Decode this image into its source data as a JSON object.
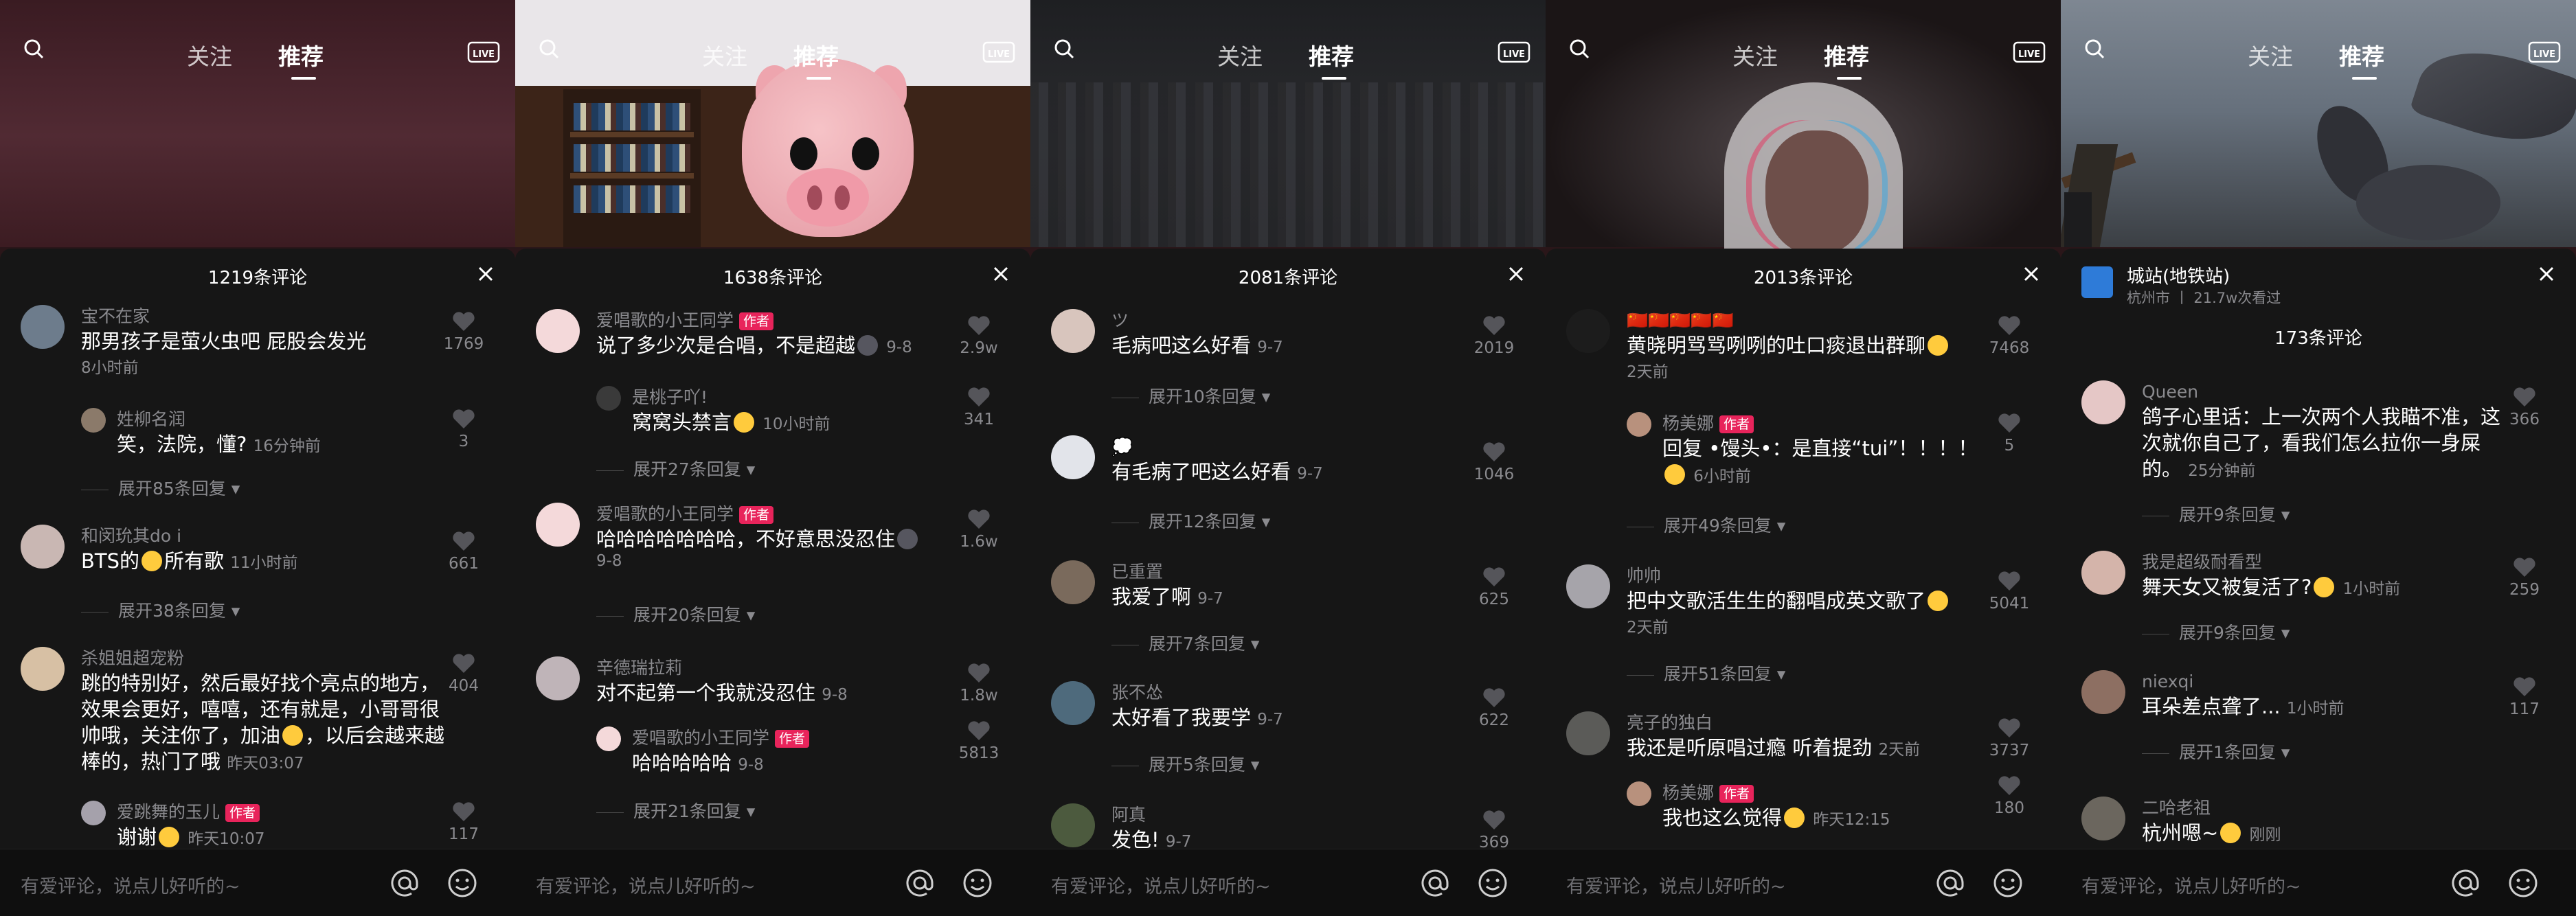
{
  "screens": [
    {
      "nav": {
        "follow": "关注",
        "recommend": "推荐"
      },
      "sheet_title": "1219条评论",
      "input_placeholder": "有爱评论，说点儿好听的~",
      "comments": [
        {
          "name": "宝不在家",
          "text": "那男孩子是萤火虫吧 屁股会发光",
          "time": "8小时前",
          "likes": "1769"
        },
        {
          "name": "姓柳名润",
          "text": "笑，法院，懂?",
          "time": "16分钟前",
          "likes": "3"
        },
        {
          "expand": "展开85条回复"
        },
        {
          "name": "和闵玧其do i",
          "text_a": "BTS的",
          "text_b": "所有歌",
          "time": "11小时前",
          "likes": "661"
        },
        {
          "expand": "展开38条回复"
        },
        {
          "name": "杀姐姐超宠粉",
          "text": "跳的特别好，然后最好找个亮点的地方，效果会更好，嘻嘻，还有就是，小哥哥很帅哦，关注你了，加油",
          "text_b": "，以后会越来越棒的，热门了哦",
          "time": "昨天03:07",
          "likes": "404"
        },
        {
          "name": "爱跳舞的玉儿",
          "author": "作者",
          "text": "谢谢",
          "time": "昨天10:07",
          "likes": "117"
        }
      ]
    },
    {
      "nav": {
        "follow": "关注",
        "recommend": "推荐"
      },
      "sheet_title": "1638条评论",
      "input_placeholder": "有爱评论，说点儿好听的~",
      "comments": [
        {
          "name": "爱唱歌的小王同学",
          "author": "作者",
          "text": "说了多少次是合唱，不是超越",
          "time": "9-8",
          "likes": "2.9w"
        },
        {
          "name": "是桃子吖!",
          "text": "窝窝头禁言",
          "time": "10小时前",
          "likes": "341"
        },
        {
          "expand": "展开27条回复"
        },
        {
          "name": "爱唱歌的小王同学",
          "author": "作者",
          "text": "哈哈哈哈哈哈哈，不好意思没忍住",
          "time": "9-8",
          "likes": "1.6w"
        },
        {
          "expand": "展开20条回复"
        },
        {
          "name": "辛德瑞拉莉",
          "text": "对不起第一个我就没忍住",
          "time": "9-8",
          "likes": "1.8w"
        },
        {
          "name": "爱唱歌的小王同学",
          "author": "作者",
          "text": "哈哈哈哈哈",
          "time": "9-8",
          "likes": "5813"
        },
        {
          "expand": "展开21条回复"
        }
      ]
    },
    {
      "nav": {
        "follow": "关注",
        "recommend": "推荐"
      },
      "sheet_title": "2081条评论",
      "input_placeholder": "有爱评论，说点儿好听的~",
      "comments": [
        {
          "name": "ツ",
          "text": "毛病吧这么好看",
          "time": "9-7",
          "likes": "2019"
        },
        {
          "expand": "展开10条回复"
        },
        {
          "name": "💭",
          "text": "有毛病了吧这么好看",
          "time": "9-7",
          "likes": "1046"
        },
        {
          "expand": "展开12条回复"
        },
        {
          "name": "已重置",
          "text": "我爱了啊",
          "time": "9-7",
          "likes": "625"
        },
        {
          "expand": "展开7条回复"
        },
        {
          "name": "张不怂",
          "text": "太好看了我要学",
          "time": "9-7",
          "likes": "622"
        },
        {
          "expand": "展开5条回复"
        },
        {
          "name": "阿真",
          "text": "发色!",
          "time": "9-7",
          "likes": "369"
        }
      ]
    },
    {
      "nav": {
        "follow": "关注",
        "recommend": "推荐"
      },
      "sheet_title": "2013条评论",
      "input_placeholder": "有爱评论，说点儿好听的~",
      "comments": [
        {
          "name": "🇨🇳🇨🇳🇨🇳🇨🇳🇨🇳",
          "text": "黄晓明骂骂咧咧的吐口痰退出群聊",
          "time": "2天前",
          "likes": "7468"
        },
        {
          "name": "杨美娜",
          "author": "作者",
          "text": "回复 •馒头•：是直接“tui”！！！！",
          "time": "6小时前",
          "likes": "5"
        },
        {
          "expand": "展开49条回复"
        },
        {
          "name": "帅帅",
          "text": "把中文歌活生生的翻唱成英文歌了",
          "time": "2天前",
          "likes": "5041"
        },
        {
          "expand": "展开51条回复"
        },
        {
          "name": "亮子的独白",
          "text": "我还是听原唱过瘾 听着提劲",
          "time": "2天前",
          "likes": "3737"
        },
        {
          "name": "杨美娜",
          "author": "作者",
          "text": "我也这么觉得",
          "time": "昨天12:15",
          "likes": "180"
        }
      ]
    },
    {
      "nav": {
        "follow": "关注",
        "recommend": "推荐"
      },
      "location": {
        "name": "城站(地铁站)",
        "sub": "杭州市 丨 21.7w次看过"
      },
      "sheet_title": "173条评论",
      "input_placeholder": "有爱评论，说点儿好听的~",
      "comments": [
        {
          "name": "Queen",
          "text": "鸽子心里话：上一次两个人我瞄不准，这次就你自己了，看我们怎么拉你一身屎的。",
          "time": "25分钟前",
          "likes": "366"
        },
        {
          "expand": "展开9条回复"
        },
        {
          "name": "我是超级耐看型",
          "text": "舞天女又被复活了?",
          "time": "1小时前",
          "likes": "259"
        },
        {
          "expand": "展开9条回复"
        },
        {
          "name": "niexqi",
          "text": "耳朵差点聋了...",
          "time": "1小时前",
          "likes": "117"
        },
        {
          "expand": "展开1条回复"
        },
        {
          "name": "二哈老祖",
          "text": "杭州嗯~",
          "time": "刚刚",
          "likes": ""
        }
      ]
    }
  ],
  "icons": [
    "search-icon",
    "live-icon",
    "close-icon",
    "heart-icon",
    "at-icon",
    "smile-icon",
    "chevron-down-icon"
  ],
  "colors": {
    "author_tag": "#e8245b",
    "sheet_bg": "#161616",
    "muted_text": "#8a8a8e"
  }
}
